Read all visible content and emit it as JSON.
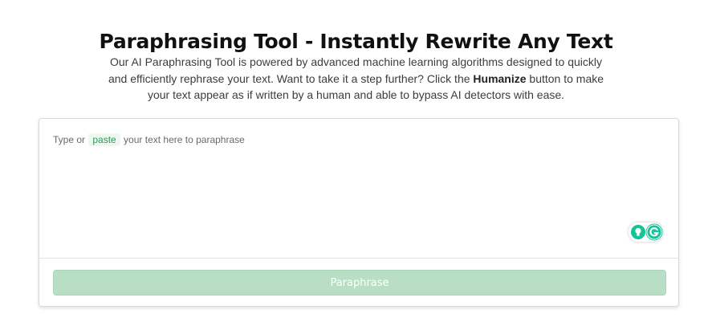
{
  "header": {
    "title": "Paraphrasing Tool - Instantly Rewrite Any Text",
    "description_line1": "Our AI Paraphrasing Tool is powered by advanced machine learning algorithms designed to quickly",
    "description_line2_before": "and efficiently rephrase your text. Want to take it a step further? Click the ",
    "description_line2_bold": "Humanize",
    "description_line2_after": " button to make",
    "description_line3": "your text appear as if written by a human and able to bypass AI detectors with ease."
  },
  "editor": {
    "placeholder_before": "Type or ",
    "paste_label": "paste",
    "placeholder_after": " your text here to paraphrase",
    "extension_icons": [
      "lightbulb-icon",
      "grammarly-icon"
    ],
    "button_label": "Paraphrase"
  },
  "colors": {
    "button_bg": "#b8dfc5",
    "paste_green": "#2e9a59",
    "grammarly_green": "#15c39a"
  }
}
